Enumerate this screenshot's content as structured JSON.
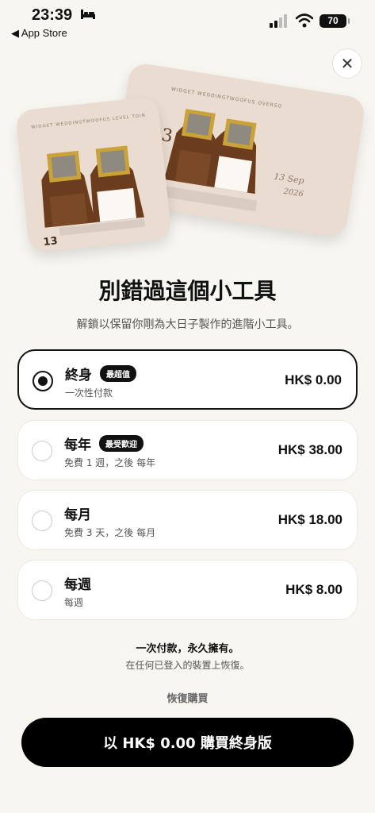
{
  "status_bar": {
    "time": "23:39",
    "back_label": "◀ App Store",
    "battery": "70"
  },
  "hero": {
    "card_front_text": "WIDGET WEDDINGTWOOFUS LEVEL TOIN",
    "card_front_number": "13",
    "card_back_text": "WIDGET WEDDINGTWOOFUS OVERSO",
    "card_back_date": "13 Sep",
    "card_back_year": "2026",
    "card_back_number": "3"
  },
  "header": {
    "title": "別錯過這個小工具",
    "subtitle": "解鎖以保留你剛為大日子製作的進階小工具。"
  },
  "plans": [
    {
      "name": "終身",
      "badge": "最超值",
      "sub": "一次性付款",
      "price": "HK$ 0.00",
      "selected": true
    },
    {
      "name": "每年",
      "badge": "最受歡迎",
      "sub": "免費 1 週，之後 每年",
      "price": "HK$ 38.00",
      "selected": false
    },
    {
      "name": "每月",
      "badge": "",
      "sub": "免費 3 天，之後 每月",
      "price": "HK$ 18.00",
      "selected": false
    },
    {
      "name": "每週",
      "badge": "",
      "sub": "每週",
      "price": "HK$ 8.00",
      "selected": false
    }
  ],
  "footer": {
    "note_bold": "一次付款，永久擁有。",
    "note": "在任何已登入的裝置上恢復。",
    "restore_label": "恢復購買",
    "cta_label": "以 HK$ 0.00 購買終身版"
  },
  "icons": {
    "close": "close-icon",
    "bed": "bed-icon",
    "signal": "signal-icon",
    "wifi": "wifi-icon"
  }
}
